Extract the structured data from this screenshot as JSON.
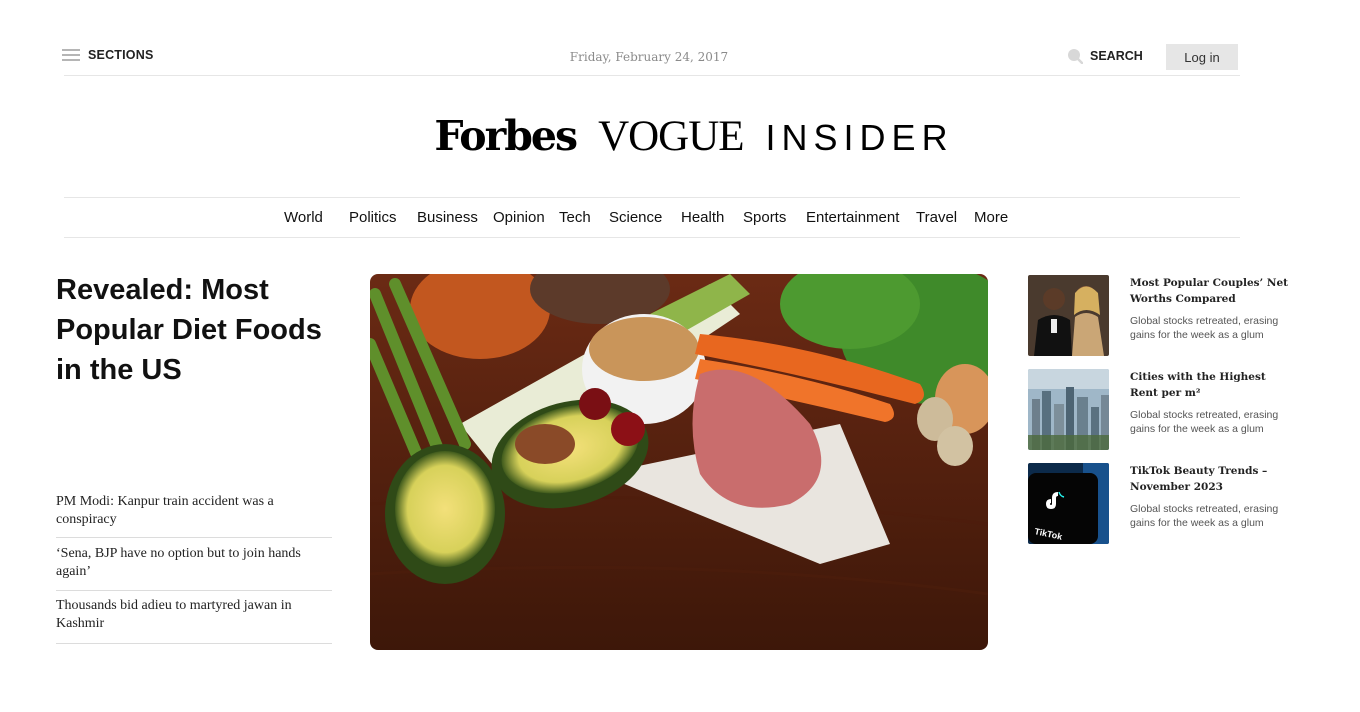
{
  "header": {
    "sections_label": "SECTIONS",
    "date": "Friday, February 24, 2017",
    "search_label": "SEARCH",
    "login_label": "Log in"
  },
  "logos": {
    "forbes": "Forbes",
    "vogue": "VOGUE",
    "insider": "INSIDER"
  },
  "nav": [
    "World",
    "Politics",
    "Business",
    "Opinion",
    "Tech",
    "Science",
    "Health",
    "Sports",
    "Entertainment",
    "Travel",
    "More"
  ],
  "main": {
    "headline": "Revealed: Most Popular Diet Foods in the US",
    "stories": [
      "PM Modi: Kanpur train accident was a conspiracy",
      "‘Sena, BJP have no option but to join hands again’",
      "Thousands bid adieu to martyred jawan in Kashmir"
    ]
  },
  "sidebar": [
    {
      "title": "Most Popular Couples’ Net Worths Compared",
      "desc": "Global stocks retreated, erasing gains for the week as a glum"
    },
    {
      "title": "Cities with the Highest Rent per m²",
      "desc": "Global stocks retreated, erasing gains for the week as a glum"
    },
    {
      "title": "TikTok Beauty Trends – November 2023",
      "desc": "Global stocks retreated, erasing gains for the week as a glum",
      "logo_text": "TikTok"
    }
  ]
}
